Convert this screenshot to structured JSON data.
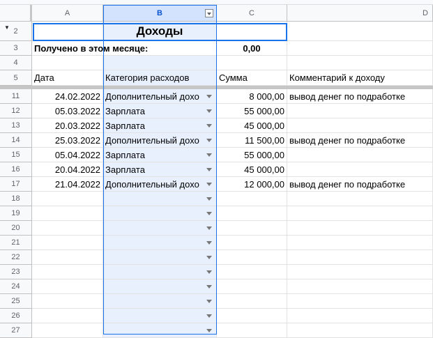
{
  "columns": [
    "A",
    "B",
    "C",
    "D"
  ],
  "title": "Доходы",
  "summary": {
    "label": "Получено в этом месяце:",
    "value": "0,00"
  },
  "headers": {
    "date": "Дата",
    "category": "Категория расходов",
    "amount": "Сумма",
    "comment": "Комментарий к доходу"
  },
  "row_numbers": {
    "r2": "2",
    "r3": "3",
    "r4": "4",
    "r5": "5"
  },
  "rows": [
    {
      "num": "11",
      "date": "24.02.2022",
      "category": "Дополнительный дохо",
      "amount": "8 000,00",
      "comment": "вывод денег по подработке"
    },
    {
      "num": "12",
      "date": "05.03.2022",
      "category": "Зарплата",
      "amount": "55 000,00",
      "comment": ""
    },
    {
      "num": "13",
      "date": "20.03.2022",
      "category": "Зарплата",
      "amount": "45 000,00",
      "comment": ""
    },
    {
      "num": "14",
      "date": "25.03.2022",
      "category": "Дополнительный дохо",
      "amount": "11 500,00",
      "comment": "вывод денег по подработке"
    },
    {
      "num": "15",
      "date": "05.04.2022",
      "category": "Зарплата",
      "amount": "55 000,00",
      "comment": ""
    },
    {
      "num": "16",
      "date": "20.04.2022",
      "category": "Зарплата",
      "amount": "45 000,00",
      "comment": ""
    },
    {
      "num": "17",
      "date": "21.04.2022",
      "category": "Дополнительный дохо",
      "amount": "12 000,00",
      "comment": "вывод денег по подработке"
    },
    {
      "num": "18",
      "date": "",
      "category": "",
      "amount": "",
      "comment": ""
    },
    {
      "num": "19",
      "date": "",
      "category": "",
      "amount": "",
      "comment": ""
    },
    {
      "num": "20",
      "date": "",
      "category": "",
      "amount": "",
      "comment": ""
    },
    {
      "num": "21",
      "date": "",
      "category": "",
      "amount": "",
      "comment": ""
    },
    {
      "num": "22",
      "date": "",
      "category": "",
      "amount": "",
      "comment": ""
    },
    {
      "num": "23",
      "date": "",
      "category": "",
      "amount": "",
      "comment": ""
    },
    {
      "num": "24",
      "date": "",
      "category": "",
      "amount": "",
      "comment": ""
    },
    {
      "num": "25",
      "date": "",
      "category": "",
      "amount": "",
      "comment": ""
    },
    {
      "num": "26",
      "date": "",
      "category": "",
      "amount": "",
      "comment": ""
    },
    {
      "num": "27",
      "date": "",
      "category": "",
      "amount": "",
      "comment": ""
    }
  ]
}
